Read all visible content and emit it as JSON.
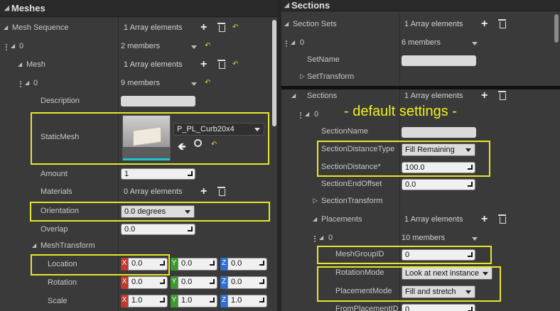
{
  "colors": {
    "highlight": "#e6e62a",
    "x_axis": "#c0392b",
    "y_axis": "#3a9a2c",
    "z_axis": "#2f6fd0",
    "annotation": "#f0f020"
  },
  "left": {
    "header": "Meshes",
    "rows": {
      "mesh_sequence": {
        "label": "Mesh Sequence",
        "value": "1 Array elements"
      },
      "index0": {
        "label": "0",
        "value": "2 members"
      },
      "mesh": {
        "label": "Mesh",
        "value": "1 Array elements"
      },
      "mesh0": {
        "label": "0",
        "value": "9 members"
      },
      "description": {
        "label": "Description"
      },
      "static_mesh": {
        "label": "StaticMesh",
        "asset": "P_PL_Curb20x4"
      },
      "amount": {
        "label": "Amount",
        "value": "1"
      },
      "materials": {
        "label": "Materials",
        "value": "0 Array elements"
      },
      "orientation": {
        "label": "Orientation",
        "value": "0.0 degrees"
      },
      "overlap": {
        "label": "Overlap",
        "value": "0.0"
      },
      "mesh_transform": {
        "label": "MeshTransform"
      },
      "location": {
        "label": "Location",
        "x": "0.0",
        "y": "0.0",
        "z": "0.0"
      },
      "rotation": {
        "label": "Rotation",
        "x": "0.0",
        "y": "0.0",
        "z": "0.0"
      },
      "scale": {
        "label": "Scale",
        "x": "1.0",
        "y": "1.0",
        "z": "1.0"
      }
    },
    "axes": {
      "x": "X",
      "y": "Y",
      "z": "Z"
    }
  },
  "right": {
    "header": "Sections",
    "annotation": "- default settings -",
    "rows": {
      "section_sets": {
        "label": "Section Sets",
        "value": "1 Array elements"
      },
      "ss0": {
        "label": "0",
        "value": "6 members"
      },
      "set_name": {
        "label": "SetName"
      },
      "set_transform": {
        "label": "SetTransform"
      },
      "sections": {
        "label": "Sections",
        "value": "1 Array elements"
      },
      "sec0": {
        "label": "0"
      },
      "section_name": {
        "label": "SectionName"
      },
      "section_distance_type": {
        "label": "SectionDistanceType",
        "value": "Fill Remaining"
      },
      "section_distance": {
        "label": "SectionDistance*",
        "value": "100.0"
      },
      "section_end_offset": {
        "label": "SectionEndOffset",
        "value": "0.0"
      },
      "section_transform": {
        "label": "SectionTransform"
      },
      "placements": {
        "label": "Placements",
        "value": "1 Array elements"
      },
      "pl0": {
        "label": "0",
        "value": "10 members"
      },
      "mesh_group_id": {
        "label": "MeshGroupID",
        "value": "0"
      },
      "rotation_mode": {
        "label": "RotationMode",
        "value": "Look at next instance"
      },
      "placement_mode": {
        "label": "PlacementMode",
        "value": "Fill and stretch"
      },
      "from_placement_id": {
        "label": "FromPlacementID",
        "value": "0"
      }
    }
  }
}
